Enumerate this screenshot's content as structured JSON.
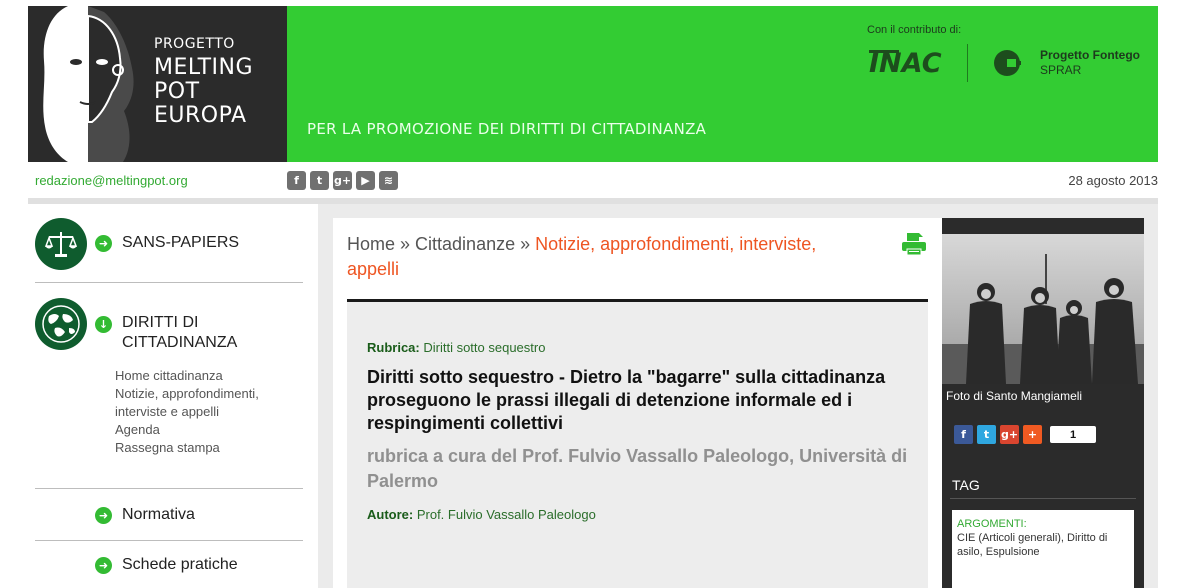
{
  "header": {
    "brand_small": "PROGETTO",
    "brand_line1": "MELTING",
    "brand_line2": "POT",
    "brand_line3": "EUROPA",
    "tagline": "PER LA PROMOZIONE DEI DIRITTI DI CITTADINANZA",
    "contrib_label": "Con il contributo di:",
    "sponsor1": "INAC",
    "sponsor2_line1": "Progetto Fontego",
    "sponsor2_line2": "SPRAR",
    "colors": {
      "dark": "#2b2b2b",
      "green": "#33cc33"
    }
  },
  "subbar": {
    "email": "redazione@meltingpot.org",
    "social_icons": [
      "facebook-icon",
      "twitter-icon",
      "google-plus-icon",
      "youtube-icon",
      "rss-icon"
    ],
    "date": "28 agosto 2013"
  },
  "sidebar": {
    "sans_papiers": "SANS-PAPIERS",
    "diritti_line1": "DIRITTI DI",
    "diritti_line2": "CITTADINANZA",
    "sub_items": [
      "Home cittadinanza",
      "Notizie, approfondimenti,",
      "interviste e appelli",
      "Agenda",
      "Rassegna stampa"
    ],
    "normativa": "Normativa",
    "schede": "Schede pratiche"
  },
  "content": {
    "crumb_home": "Home",
    "crumb_sep1": " » ",
    "crumb_cat": "Cittadinanze",
    "crumb_sep2": " » ",
    "crumb_current": "Notizie, approfondimenti, interviste, appelli",
    "rubrica_label": "Rubrica:",
    "rubrica_value": "Diritti sotto sequestro",
    "title": "Diritti sotto sequestro - Dietro la \"bagarre\" sulla cittadinanza proseguono le prassi illegali di detenzione informale ed i respingimenti collettivi",
    "subtitle": "rubrica a cura del Prof. Fulvio Vassallo Paleologo, Università di Palermo",
    "autore_label": "Autore:",
    "autore_value": "Prof. Fulvio Vassallo Paleologo"
  },
  "right": {
    "photo_caption": "Foto di Santo Mangiameli",
    "share_count": "1",
    "tag_heading": "TAG",
    "argomenti_label": "ARGOMENTI:",
    "argomenti_value": "CIE (Articoli generali), Diritto di asilo, Espulsione"
  }
}
